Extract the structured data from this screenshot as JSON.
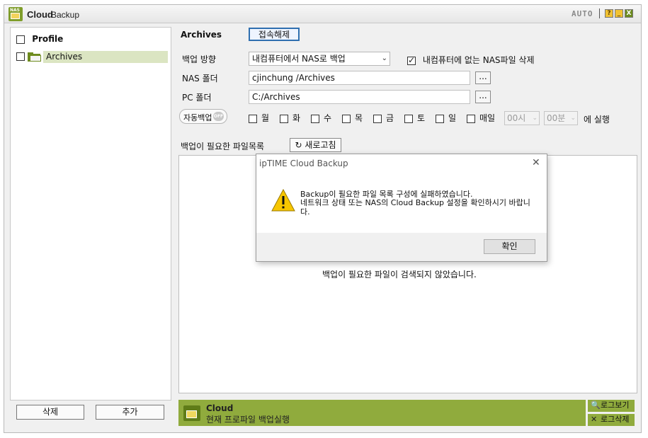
{
  "window": {
    "title_main": "Cloud",
    "title_sub": "Backup",
    "logo_text": "NAS",
    "auto_label": "AUTO",
    "help_glyph": "?",
    "minimize_glyph": "_",
    "close_glyph": "X",
    "accent_color": "#90ab3d"
  },
  "sidebar": {
    "header_label": "Profile",
    "items": [
      {
        "label": "Archives",
        "selected": true
      }
    ],
    "delete_label": "삭제",
    "add_label": "추가"
  },
  "profile": {
    "title": "Archives",
    "disconnect_label": "접속해제",
    "direction_label": "백업 방향",
    "direction_value": "내컴퓨터에서 NAS로 백업",
    "delete_nas_label": "내컴퓨터에 없는 NAS파일 삭제",
    "delete_nas_checked": true,
    "nas_folder_label": "NAS 폴더",
    "nas_folder_value": "cjinchung /Archives",
    "pc_folder_label": "PC 폴더",
    "pc_folder_value": "C:/Archives",
    "browse_label": "...",
    "auto_backup_label": "자동백업",
    "auto_backup_state": "OFF",
    "days": [
      "월",
      "화",
      "수",
      "목",
      "금",
      "토",
      "일",
      "매일"
    ],
    "hour_value": "00시",
    "minute_value": "00분",
    "run_label": "에 실행"
  },
  "files": {
    "list_label": "백업이 필요한 파일목록",
    "refresh_label": "새로고침",
    "refresh_icon": "↻",
    "empty_message": "백업이 필요한 파일이 검색되지 않았습니다."
  },
  "bottom": {
    "title": "Cloud",
    "subtitle": "현재 프로파일 백업실행",
    "log_view_label": "로그보기",
    "log_delete_label": "로그삭제"
  },
  "dialog": {
    "title": "ipTIME Cloud Backup",
    "close_glyph": "✕",
    "message_line1": "Backup이 필요한 파일 목록 구성에 실패하였습니다.",
    "message_line2": "네트워크 상태 또는 NAS의 Cloud Backup 설정을 확인하시기 바랍니다.",
    "ok_label": "확인"
  }
}
